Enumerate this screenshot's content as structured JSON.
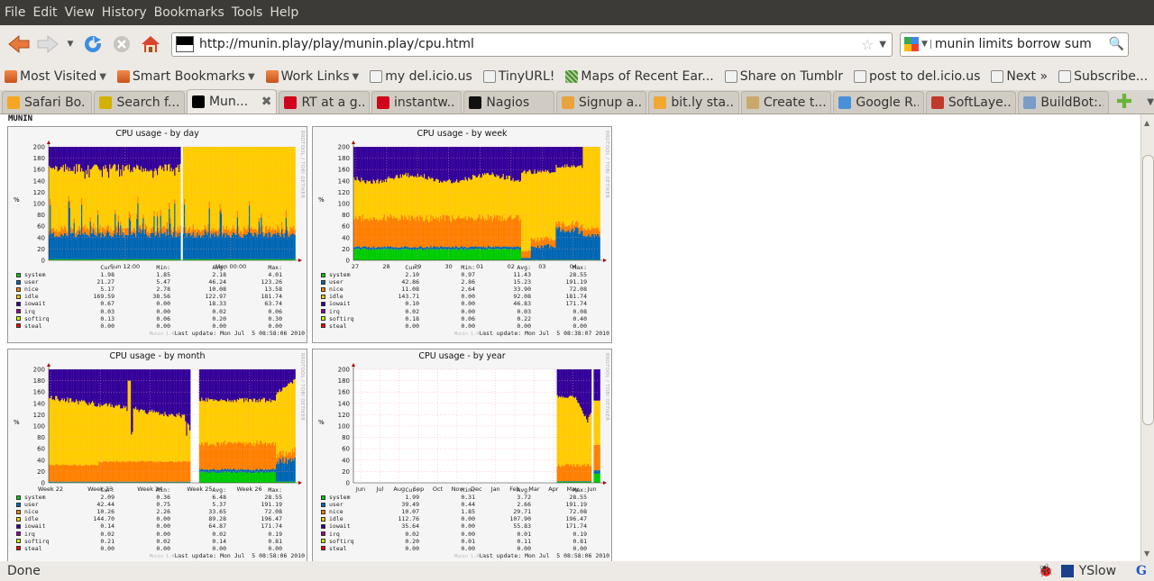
{
  "menu": [
    "File",
    "Edit",
    "View",
    "History",
    "Bookmarks",
    "Tools",
    "Help"
  ],
  "menu_accel": [
    "F",
    "E",
    "V",
    "s",
    "B",
    "T",
    "H"
  ],
  "nav": {
    "url": "http://munin.play/play/munin.play/cpu.html",
    "search_value": "munin limits borrow sum"
  },
  "bookmarks": [
    {
      "label": "Most Visited",
      "icon": "folder",
      "dropdown": true
    },
    {
      "label": "Smart Bookmarks",
      "icon": "folder",
      "dropdown": true
    },
    {
      "label": "Work Links",
      "icon": "folder",
      "dropdown": true
    },
    {
      "label": "my del.icio.us",
      "icon": "page",
      "dropdown": false
    },
    {
      "label": "TinyURL!",
      "icon": "page",
      "dropdown": false
    },
    {
      "label": "Maps of Recent Ear...",
      "icon": "map",
      "dropdown": false
    },
    {
      "label": "Share on Tumblr",
      "icon": "page",
      "dropdown": false
    },
    {
      "label": "post to del.icio.us",
      "icon": "page",
      "dropdown": false
    },
    {
      "label": "Next »",
      "icon": "page",
      "dropdown": false
    },
    {
      "label": "Subscribe...",
      "icon": "page",
      "dropdown": false
    }
  ],
  "tabs": [
    {
      "label": "Safari Bo...",
      "icon_color": "#f5a623",
      "active": false
    },
    {
      "label": "Search f...",
      "icon_color": "#d4b106",
      "active": false
    },
    {
      "label": "Mun...",
      "icon_color": "#000000",
      "active": true
    },
    {
      "label": "RT at a g...",
      "icon_color": "#d0021b",
      "active": false
    },
    {
      "label": "instantw...",
      "icon_color": "#d0021b",
      "active": false
    },
    {
      "label": "Nagios",
      "icon_color": "#111111",
      "active": false
    },
    {
      "label": "Signup a...",
      "icon_color": "#e8a33d",
      "active": false
    },
    {
      "label": "bit.ly sta...",
      "icon_color": "#f0a830",
      "active": false
    },
    {
      "label": "Create t...",
      "icon_color": "#c9a86a",
      "active": false
    },
    {
      "label": "Google R...",
      "icon_color": "#4a90d9",
      "active": false
    },
    {
      "label": "SoftLaye...",
      "icon_color": "#c0392b",
      "active": false
    },
    {
      "label": "BuildBot:...",
      "icon_color": "#7a9cc6",
      "active": false
    }
  ],
  "page": {
    "logo": "MUNIN",
    "rrd_credit": "RRDTOOL / TOBI OETIKER",
    "munin_version": "Munin 1.4.4"
  },
  "series_colors": {
    "system": "#00cc00",
    "user": "#0066b3",
    "nice": "#ff8000",
    "idle": "#ffcc00",
    "iowait": "#330099",
    "irq": "#990099",
    "softirq": "#ccff00",
    "steal": "#ff0000"
  },
  "chart_data": [
    {
      "type": "area",
      "title": "CPU usage - by day",
      "ylabel": "%",
      "ylim": [
        0,
        200
      ],
      "yticks": [
        0,
        20,
        40,
        60,
        80,
        100,
        120,
        140,
        160,
        180,
        200
      ],
      "xticks": [
        "Sun 12:00",
        "Mon 00:00"
      ],
      "stack_profile": {
        "system": 2,
        "user": 40,
        "nice": 8,
        "idle": 110,
        "iowait": 40,
        "gap_at": 0.53,
        "idle_only_after_gap": true
      },
      "legend_header": [
        "Cur:",
        "Min:",
        "Avg:",
        "Max:"
      ],
      "legend": [
        {
          "name": "system",
          "cur": "1.98",
          "min": "1.85",
          "avg": "2.18",
          "max": "4.01"
        },
        {
          "name": "user",
          "cur": "21.27",
          "min": "5.47",
          "avg": "46.24",
          "max": "123.26"
        },
        {
          "name": "nice",
          "cur": "5.17",
          "min": "2.78",
          "avg": "10.08",
          "max": "13.58"
        },
        {
          "name": "idle",
          "cur": "169.59",
          "min": "38.56",
          "avg": "122.97",
          "max": "181.74"
        },
        {
          "name": "iowait",
          "cur": "0.67",
          "min": "0.00",
          "avg": "18.33",
          "max": "63.74"
        },
        {
          "name": "irq",
          "cur": "0.03",
          "min": "0.00",
          "avg": "0.02",
          "max": "0.06"
        },
        {
          "name": "softirq",
          "cur": "0.13",
          "min": "0.06",
          "avg": "0.20",
          "max": "0.30"
        },
        {
          "name": "steal",
          "cur": "0.00",
          "min": "0.00",
          "avg": "0.00",
          "max": "0.00"
        }
      ],
      "last_update": "Last update: Mon Jul  5 08:58:06 2010"
    },
    {
      "type": "area",
      "title": "CPU usage - by week",
      "ylabel": "%",
      "ylim": [
        0,
        200
      ],
      "yticks": [
        0,
        20,
        40,
        60,
        80,
        100,
        120,
        140,
        160,
        180,
        200
      ],
      "xticks": [
        "27",
        "28",
        "29",
        "30",
        "01",
        "02",
        "03",
        "04"
      ],
      "legend_header": [
        "Cur:",
        "Min:",
        "Avg:",
        "Max:"
      ],
      "legend": [
        {
          "name": "system",
          "cur": "2.10",
          "min": "0.97",
          "avg": "11.43",
          "max": "28.55"
        },
        {
          "name": "user",
          "cur": "42.86",
          "min": "2.86",
          "avg": "15.23",
          "max": "191.19"
        },
        {
          "name": "nice",
          "cur": "11.08",
          "min": "2.64",
          "avg": "33.90",
          "max": "72.08"
        },
        {
          "name": "idle",
          "cur": "143.71",
          "min": "0.00",
          "avg": "92.08",
          "max": "181.74"
        },
        {
          "name": "iowait",
          "cur": "0.10",
          "min": "0.00",
          "avg": "46.83",
          "max": "171.74"
        },
        {
          "name": "irq",
          "cur": "0.02",
          "min": "0.00",
          "avg": "0.03",
          "max": "0.08"
        },
        {
          "name": "softirq",
          "cur": "0.18",
          "min": "0.06",
          "avg": "0.22",
          "max": "0.40"
        },
        {
          "name": "steal",
          "cur": "0.00",
          "min": "0.00",
          "avg": "0.00",
          "max": "0.00"
        }
      ],
      "last_update": "Last update: Mon Jul  5 08:38:07 2010"
    },
    {
      "type": "area",
      "title": "CPU usage - by month",
      "ylabel": "%",
      "ylim": [
        0,
        200
      ],
      "yticks": [
        0,
        20,
        40,
        60,
        80,
        100,
        120,
        140,
        160,
        180,
        200
      ],
      "xticks": [
        "Week 22",
        "Week 23",
        "Week 24",
        "Week 25",
        "Week 26"
      ],
      "legend_header": [
        "Cur:",
        "Min:",
        "Avg:",
        "Max:"
      ],
      "legend": [
        {
          "name": "system",
          "cur": "2.09",
          "min": "0.36",
          "avg": "6.48",
          "max": "28.55"
        },
        {
          "name": "user",
          "cur": "42.44",
          "min": "0.75",
          "avg": "5.37",
          "max": "191.19"
        },
        {
          "name": "nice",
          "cur": "10.26",
          "min": "2.26",
          "avg": "33.65",
          "max": "72.08"
        },
        {
          "name": "idle",
          "cur": "144.70",
          "min": "0.00",
          "avg": "89.28",
          "max": "196.47"
        },
        {
          "name": "iowait",
          "cur": "0.14",
          "min": "0.00",
          "avg": "64.87",
          "max": "171.74"
        },
        {
          "name": "irq",
          "cur": "0.02",
          "min": "0.00",
          "avg": "0.02",
          "max": "0.19"
        },
        {
          "name": "softirq",
          "cur": "0.21",
          "min": "0.02",
          "avg": "0.14",
          "max": "0.81"
        },
        {
          "name": "steal",
          "cur": "0.00",
          "min": "0.00",
          "avg": "0.00",
          "max": "0.00"
        }
      ],
      "last_update": "Last update: Mon Jul  5 08:58:06 2010"
    },
    {
      "type": "area",
      "title": "CPU usage - by year",
      "ylabel": "%",
      "ylim": [
        0,
        200
      ],
      "yticks": [
        0,
        20,
        40,
        60,
        80,
        100,
        120,
        140,
        160,
        180,
        200
      ],
      "xticks": [
        "Jun",
        "Jul",
        "Aug",
        "Sep",
        "Oct",
        "Nov",
        "Dec",
        "Jan",
        "Feb",
        "Mar",
        "Apr",
        "May",
        "Jun"
      ],
      "legend_header": [
        "Cur:",
        "Min:",
        "Avg:",
        "Max:"
      ],
      "legend": [
        {
          "name": "system",
          "cur": "1.99",
          "min": "0.31",
          "avg": "3.72",
          "max": "28.55"
        },
        {
          "name": "user",
          "cur": "39.49",
          "min": "0.44",
          "avg": "2.66",
          "max": "191.19"
        },
        {
          "name": "nice",
          "cur": "10.07",
          "min": "1.85",
          "avg": "29.71",
          "max": "72.08"
        },
        {
          "name": "idle",
          "cur": "112.76",
          "min": "0.00",
          "avg": "107.90",
          "max": "196.47"
        },
        {
          "name": "iowait",
          "cur": "35.64",
          "min": "0.00",
          "avg": "55.83",
          "max": "171.74"
        },
        {
          "name": "irq",
          "cur": "0.02",
          "min": "0.00",
          "avg": "0.01",
          "max": "0.19"
        },
        {
          "name": "softirq",
          "cur": "0.20",
          "min": "0.01",
          "avg": "0.11",
          "max": "0.81"
        },
        {
          "name": "steal",
          "cur": "0.00",
          "min": "0.00",
          "avg": "0.00",
          "max": "0.00"
        }
      ],
      "last_update": "Last update: Mon Jul  5 08:58:06 2010"
    }
  ],
  "status": {
    "text": "Done",
    "yslow": "YSlow"
  }
}
